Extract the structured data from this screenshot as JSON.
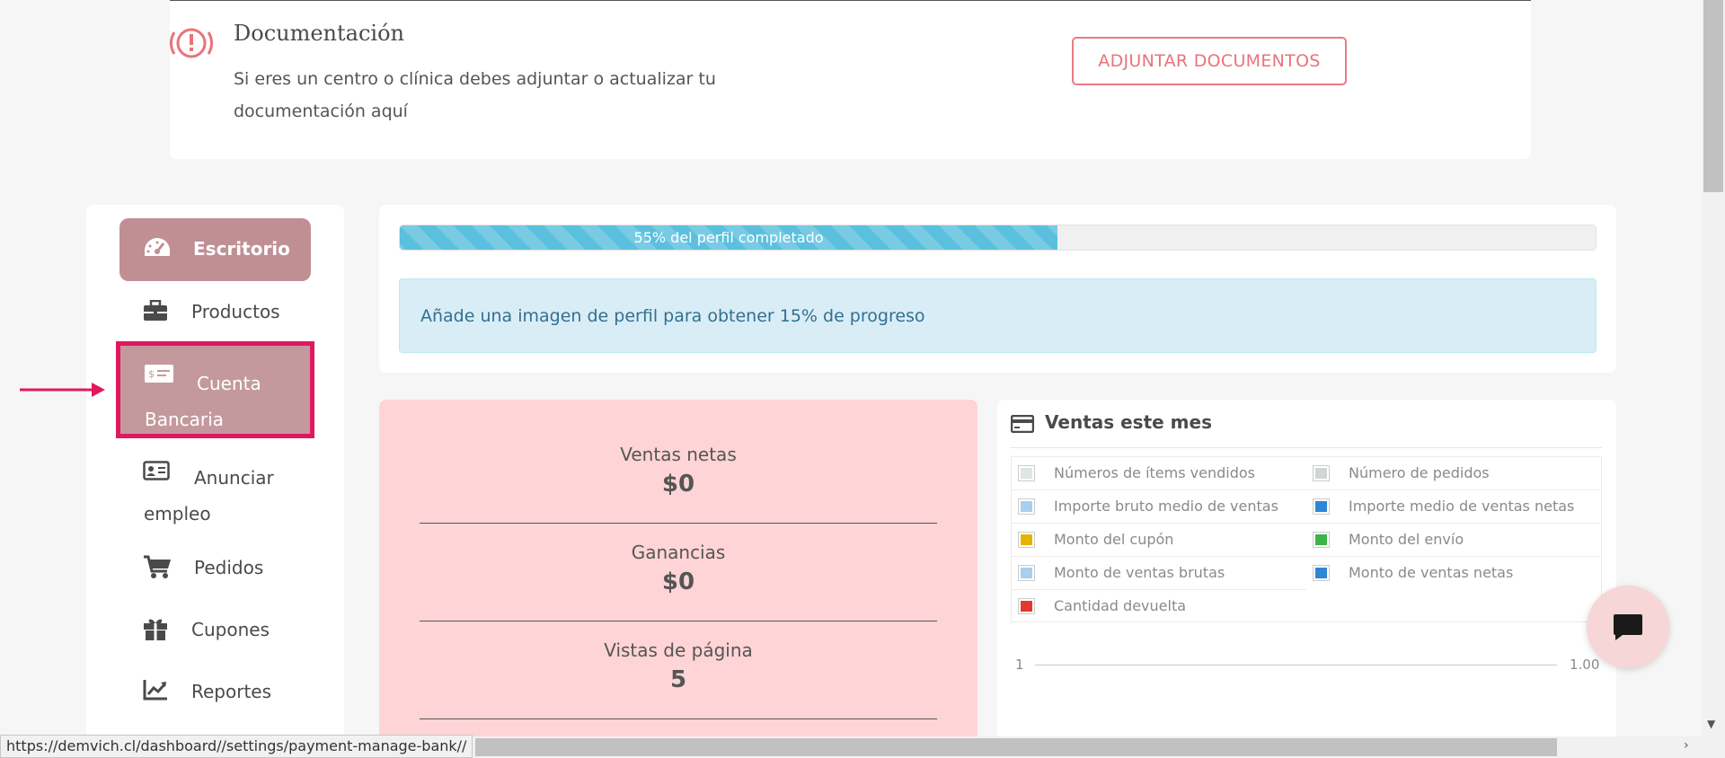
{
  "documentation": {
    "title": "Documentación",
    "text": "Si eres un centro o clínica debes adjuntar o actualizar tu documentación aquí",
    "button_label": "ADJUNTAR DOCUMENTOS"
  },
  "sidebar": {
    "items": [
      {
        "label": "Escritorio",
        "icon": "tachometer-icon"
      },
      {
        "label": "Productos",
        "icon": "briefcase-icon"
      },
      {
        "label": "Cuenta Bancaria",
        "icon": "bank-card-icon"
      },
      {
        "label": "Anunciar empleo",
        "icon": "id-card-icon"
      },
      {
        "label": "Pedidos",
        "icon": "cart-icon"
      },
      {
        "label": "Cupones",
        "icon": "gift-icon"
      },
      {
        "label": "Reportes",
        "icon": "chart-line-icon"
      }
    ]
  },
  "progress": {
    "value_percent": 55,
    "label": "55% del perfil completado",
    "tip": "Añade una imagen de perfil para obtener 15% de progreso"
  },
  "stats": [
    {
      "label": "Ventas netas",
      "value": "$0"
    },
    {
      "label": "Ganancias",
      "value": "$0"
    },
    {
      "label": "Vistas de página",
      "value": "5"
    }
  ],
  "sales_month": {
    "title": "Ventas este mes",
    "legend": [
      {
        "label": "Números de ítems vendidos",
        "color": "#dfe5e5"
      },
      {
        "label": "Número de pedidos",
        "color": "#d0d6d6"
      },
      {
        "label": "Importe bruto medio de ventas",
        "color": "#a8cfee"
      },
      {
        "label": "Importe medio de ventas netas",
        "color": "#2e86d4"
      },
      {
        "label": "Monto del cupón",
        "color": "#e5b400"
      },
      {
        "label": "Monto del envío",
        "color": "#3bb44a"
      },
      {
        "label": "Monto de ventas brutas",
        "color": "#a8cfee"
      },
      {
        "label": "Monto de ventas netas",
        "color": "#2e86d4"
      },
      {
        "label": "Cantidad devuelta",
        "color": "#e03a2f"
      }
    ],
    "axis_left": "1",
    "axis_right": "1.00"
  },
  "status_bar": {
    "url": "https://demvich.cl/dashboard//settings/payment-manage-bank//"
  },
  "colors": {
    "accent": "#c08f94",
    "highlight_border": "#e0185f",
    "progress": "#5bc0de",
    "stats_bg": "#ffd4d6"
  }
}
